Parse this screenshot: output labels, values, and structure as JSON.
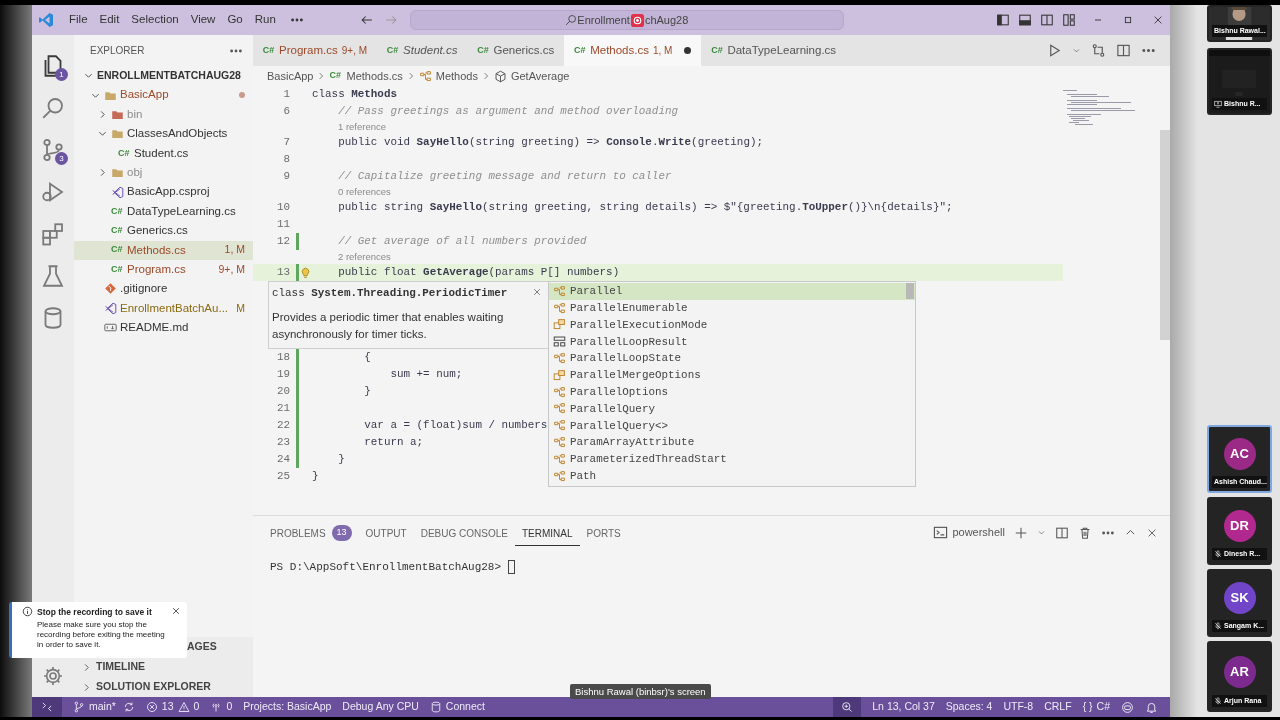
{
  "title_bar": {
    "menu": [
      "File",
      "Edit",
      "Selection",
      "View",
      "Go",
      "Run"
    ],
    "search_parts": [
      "Enrollment",
      "chAug28"
    ]
  },
  "activity_bar": [
    {
      "kind": "files",
      "badge": "1",
      "selected": true
    },
    {
      "kind": "search",
      "selected": false
    },
    {
      "kind": "source-control",
      "badge": "3",
      "selected": false
    },
    {
      "kind": "run",
      "selected": false
    },
    {
      "kind": "extensions",
      "selected": false
    },
    {
      "kind": "testing",
      "selected": false
    },
    {
      "kind": "database",
      "selected": false
    }
  ],
  "explorer": {
    "title": "EXPLORER",
    "root": {
      "label": "ENROLLMENTBATCHAUG28",
      "expanded": true,
      "children": [
        {
          "label": "BasicApp",
          "kind": "folder",
          "expanded": true,
          "color": "#9c4a2a",
          "dot": true,
          "selected": false,
          "children": [
            {
              "label": "bin",
              "kind": "build-folder",
              "expanded": false,
              "color": "#8c8c8c",
              "selected": false
            },
            {
              "label": "ClassesAndObjects",
              "kind": "folder",
              "expanded": true,
              "selected": false,
              "children": [
                {
                  "label": "Student.cs",
                  "glyph": "C#",
                  "selected": false
                }
              ]
            },
            {
              "label": "obj",
              "kind": "folder",
              "expanded": false,
              "color": "#8c8c8c",
              "selected": false
            },
            {
              "label": "BasicApp.csproj",
              "kind": "project",
              "selected": false
            },
            {
              "label": "DataTypeLearning.cs",
              "glyph": "C#",
              "selected": false
            },
            {
              "label": "Generics.cs",
              "glyph": "C#",
              "selected": false
            },
            {
              "label": "Methods.cs",
              "glyph": "C#",
              "badge": "1, M",
              "color": "#9c4a2a",
              "selected": true
            },
            {
              "label": "Program.cs",
              "glyph": "C#",
              "badge": "9+, M",
              "color": "#9c4a2a",
              "selected": false
            }
          ]
        },
        {
          "label": ".gitignore",
          "kind": "git",
          "selected": false
        },
        {
          "label": "EnrollmentBatchAu...",
          "kind": "solution",
          "badge": "M",
          "color": "#8a6a10",
          "selected": false
        },
        {
          "label": "README.md",
          "kind": "markdown",
          "selected": false
        }
      ]
    },
    "sections": [
      {
        "label": "AGES"
      },
      {
        "label": "TIMELINE",
        "expanded": false
      },
      {
        "label": "SOLUTION EXPLORER",
        "expanded": false
      }
    ]
  },
  "tabs": [
    {
      "glyph": "C#",
      "label": "Program.cs",
      "badge": "9+, M",
      "color": "#9c4a2a",
      "preview": false,
      "dirty": false,
      "selected": false
    },
    {
      "glyph": "C#",
      "label": "Student.cs",
      "preview": true,
      "dirty": false,
      "selected": false
    },
    {
      "glyph": "C#",
      "label": "Generics.cs",
      "preview": false,
      "dirty": false,
      "selected": false
    },
    {
      "glyph": "C#",
      "label": "Methods.cs",
      "badge": "1, M",
      "color": "#9c4a2a",
      "preview": false,
      "dirty": true,
      "selected": true
    },
    {
      "glyph": "C#",
      "label": "DataTypeLearning.cs",
      "preview": false,
      "dirty": false,
      "selected": false
    }
  ],
  "breadcrumb": [
    {
      "label": "BasicApp"
    },
    {
      "label": "Methods.cs",
      "glyph": "C#"
    },
    {
      "label": "Methods",
      "kind": "class"
    },
    {
      "label": "GetAverage",
      "kind": "method"
    }
  ],
  "code_lines": [
    {
      "kind": "code",
      "number": "1",
      "text": "class **Methods**",
      "modified": false,
      "current": false
    },
    {
      "kind": "comment",
      "number": "6",
      "text": "    // Pass greetings as argument and method overloading",
      "modified": false,
      "current": false
    },
    {
      "kind": "lens",
      "text": "1 reference"
    },
    {
      "kind": "code",
      "number": "7",
      "text": "    public void **SayHello**(string greeting) => **Console**.**Write**(greeting);",
      "modified": false,
      "current": false
    },
    {
      "kind": "code",
      "number": "8",
      "modified": false,
      "current": false
    },
    {
      "kind": "comment",
      "number": "9",
      "text": "    // Capitalize greeting message and return to caller",
      "modified": false,
      "current": false
    },
    {
      "kind": "lens",
      "text": "0 references"
    },
    {
      "kind": "code",
      "number": "10",
      "text": "    public string **SayHello**(string greeting, string details) => $\"{greeting.**ToUpper**()}\\n{details}\";",
      "modified": false,
      "current": false
    },
    {
      "kind": "code",
      "number": "11",
      "modified": false,
      "current": false
    },
    {
      "kind": "comment",
      "number": "12",
      "text": "    // Get average of all numbers provided",
      "modified": true,
      "current": false
    },
    {
      "kind": "lens",
      "text": "2 references"
    },
    {
      "kind": "code",
      "number": "13",
      "text": "    public float **GetAverage**(params P[] numbers)",
      "modified": true,
      "current": true
    },
    {
      "kind": "hover",
      "title": "class **System.Threading.PeriodicTimer**",
      "description": "Provides a periodic timer that enables waiting asynchronously for timer ticks."
    },
    {
      "kind": "code",
      "number": "18",
      "text": "        {",
      "modified": true,
      "current": false
    },
    {
      "kind": "code",
      "number": "19",
      "text": "            sum += num;",
      "modified": true,
      "current": false
    },
    {
      "kind": "code",
      "number": "20",
      "text": "        }",
      "modified": true,
      "current": false
    },
    {
      "kind": "code",
      "number": "21",
      "modified": true,
      "current": false
    },
    {
      "kind": "code",
      "number": "22",
      "text": "        var a = (float)sum / numbers",
      "modified": true,
      "current": false
    },
    {
      "kind": "code",
      "number": "23",
      "text": "        return a;",
      "modified": true,
      "current": false
    },
    {
      "kind": "code",
      "number": "24",
      "text": "    }",
      "modified": true,
      "current": false
    },
    {
      "kind": "code",
      "number": "25",
      "text": "}",
      "modified": false,
      "current": false
    }
  ],
  "suggestions": [
    {
      "label": "Parallel",
      "kind": "class",
      "selected": true
    },
    {
      "label": "ParallelEnumerable",
      "kind": "class",
      "selected": false
    },
    {
      "label": "ParallelExecutionMode",
      "kind": "enum",
      "selected": false
    },
    {
      "label": "ParallelLoopResult",
      "kind": "struct",
      "selected": false
    },
    {
      "label": "ParallelLoopState",
      "kind": "class",
      "selected": false
    },
    {
      "label": "ParallelMergeOptions",
      "kind": "enum",
      "selected": false
    },
    {
      "label": "ParallelOptions",
      "kind": "class",
      "selected": false
    },
    {
      "label": "ParallelQuery",
      "kind": "class",
      "selected": false
    },
    {
      "label": "ParallelQuery<>",
      "kind": "class",
      "selected": false
    },
    {
      "label": "ParamArrayAttribute",
      "kind": "class",
      "selected": false
    },
    {
      "label": "ParameterizedThreadStart",
      "kind": "class",
      "selected": false
    },
    {
      "label": "Path",
      "kind": "class",
      "selected": false
    }
  ],
  "panel": {
    "tabs": [
      {
        "label": "PROBLEMS",
        "badge": "13",
        "selected": false
      },
      {
        "label": "OUTPUT",
        "selected": false
      },
      {
        "label": "DEBUG CONSOLE",
        "selected": false
      },
      {
        "label": "TERMINAL",
        "selected": true
      },
      {
        "label": "PORTS",
        "selected": false
      }
    ],
    "terminal_name": "powershell",
    "prompt": "PS D:\\AppSoft\\EnrollmentBatchAug28> "
  },
  "status_bar": {
    "branch": "main*",
    "errors": "13",
    "warnings": "0",
    "ports": "0",
    "items_left": [
      "Projects: BasicApp",
      "Debug Any CPU"
    ],
    "connect": "Connect",
    "position": "Ln 13, Col 37",
    "items_right": [
      "Spaces: 4",
      "UTF-8",
      "CRLF"
    ],
    "language_glyph": "{ }",
    "language": "C#"
  },
  "toast": {
    "title": "Stop the recording to save it",
    "message": "Please make sure you stop the recording before exiting the meeting in order to save it."
  },
  "screen_label": "Bishnu Rawal (binbsr)'s screen",
  "participants": [
    {
      "name": "Bishnu Rawal...",
      "sharing": false,
      "muted": false,
      "active": false
    },
    {
      "kind": "video",
      "name": "Bishnu R...",
      "sharing": true,
      "muted": false,
      "active": false
    },
    {
      "kind": "avatar",
      "initials": "AC",
      "name": "Ashish Chaud...",
      "color": "#9a2a86",
      "sharing": false,
      "muted": false,
      "active": true
    },
    {
      "kind": "avatar",
      "initials": "DR",
      "name": "Dinesh R...",
      "color": "#b1288f",
      "sharing": false,
      "muted": true,
      "active": false
    },
    {
      "kind": "avatar",
      "initials": "SK",
      "name": "Sangam K...",
      "color": "#7145c8",
      "sharing": false,
      "muted": true,
      "active": false
    },
    {
      "kind": "avatar",
      "initials": "AR",
      "name": "Arjun Rana",
      "color": "#7c2a8e",
      "sharing": false,
      "muted": true,
      "active": false
    }
  ]
}
